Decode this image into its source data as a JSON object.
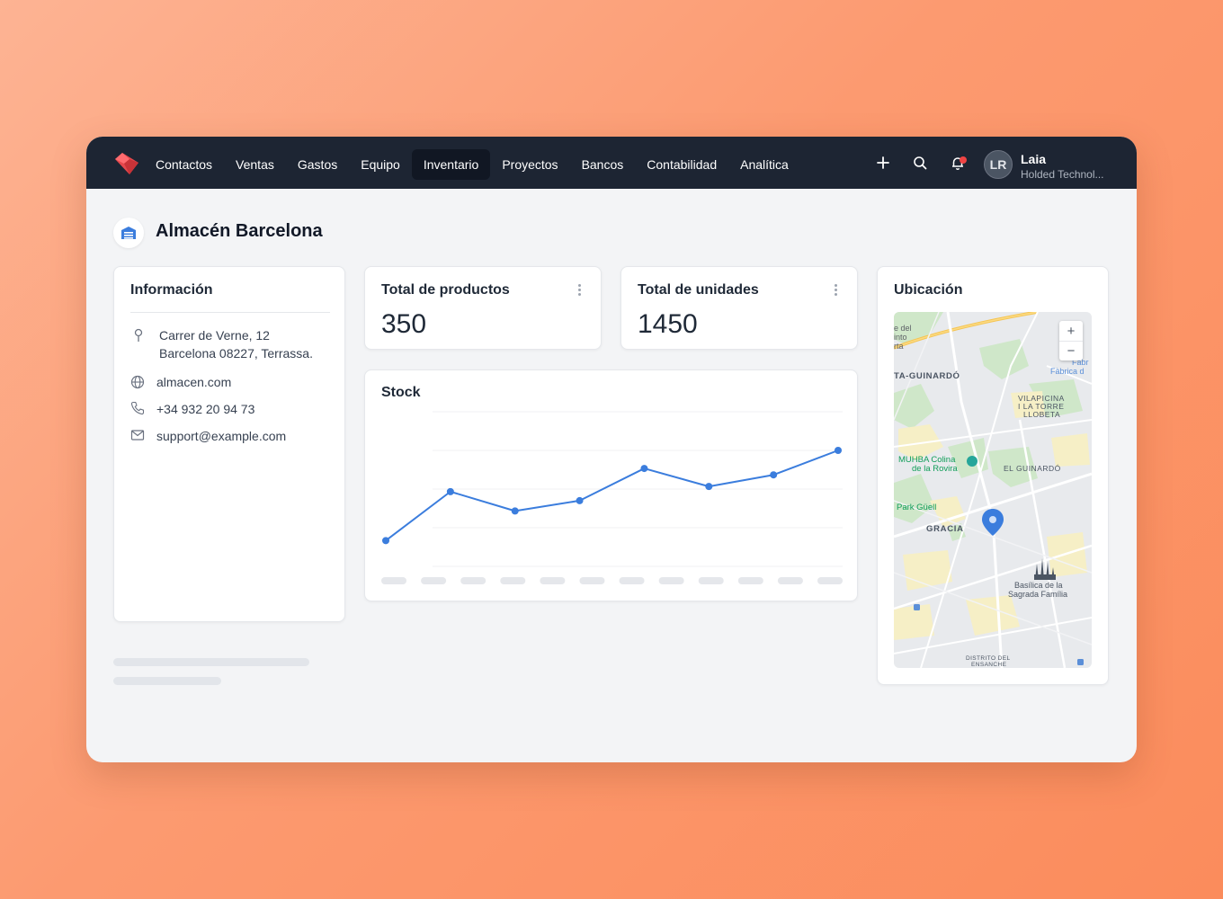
{
  "nav": {
    "items": [
      {
        "label": "Contactos",
        "active": false
      },
      {
        "label": "Ventas",
        "active": false
      },
      {
        "label": "Gastos",
        "active": false
      },
      {
        "label": "Equipo",
        "active": false
      },
      {
        "label": "Inventario",
        "active": true
      },
      {
        "label": "Proyectos",
        "active": false
      },
      {
        "label": "Bancos",
        "active": false
      },
      {
        "label": "Contabilidad",
        "active": false
      },
      {
        "label": "Analítica",
        "active": false
      }
    ]
  },
  "user": {
    "initials": "LR",
    "name": "Laia",
    "company": "Holded Technol..."
  },
  "page": {
    "title": "Almacén Barcelona"
  },
  "info": {
    "title": "Información",
    "address_line1": "Carrer de Verne, 12",
    "address_line2": "Barcelona 08227, Terrassa.",
    "website": "almacen.com",
    "phone": "+34 932 20 94 73",
    "email": "support@example.com"
  },
  "kpis": [
    {
      "title": "Total de productos",
      "value": "350"
    },
    {
      "title": "Total de unidades",
      "value": "1450"
    }
  ],
  "stock": {
    "title": "Stock"
  },
  "chart_data": {
    "type": "line",
    "title": "Stock",
    "series": [
      {
        "values": [
          20,
          58,
          43,
          51,
          76,
          62,
          71,
          90
        ]
      }
    ],
    "ylim": [
      0,
      120
    ],
    "grid": true,
    "x_label_placeholders": 12
  },
  "location": {
    "title": "Ubicación",
    "zoom_in": "+",
    "zoom_out": "−",
    "map_labels": {
      "guinardo": "TA-GUINARDÓ",
      "vilapicina": "VILAPICINA",
      "torre": "I LA TORRE",
      "llobeta": "LLOBETA",
      "muhba1": "MUHBA Colina",
      "muhba2": "de la Rovira",
      "elguinardo": "EL GUINARDÓ",
      "parkguell": "Park Güell",
      "gracia": "GRACIA",
      "basilica1": "Basílica de la",
      "basilica2": "Sagrada Família",
      "distrito1": "DISTRITO DEL",
      "distrito2": "ENSANCHE",
      "fabrica1": "Fabr",
      "fabrica2": "Fàbrica d",
      "topleft1": "e del",
      "topleft2": "into",
      "topleft3": "rta"
    }
  },
  "colors": {
    "topbar": "#1d2533",
    "accent_line": "#3b7ddd",
    "logo": "#e5484d"
  }
}
